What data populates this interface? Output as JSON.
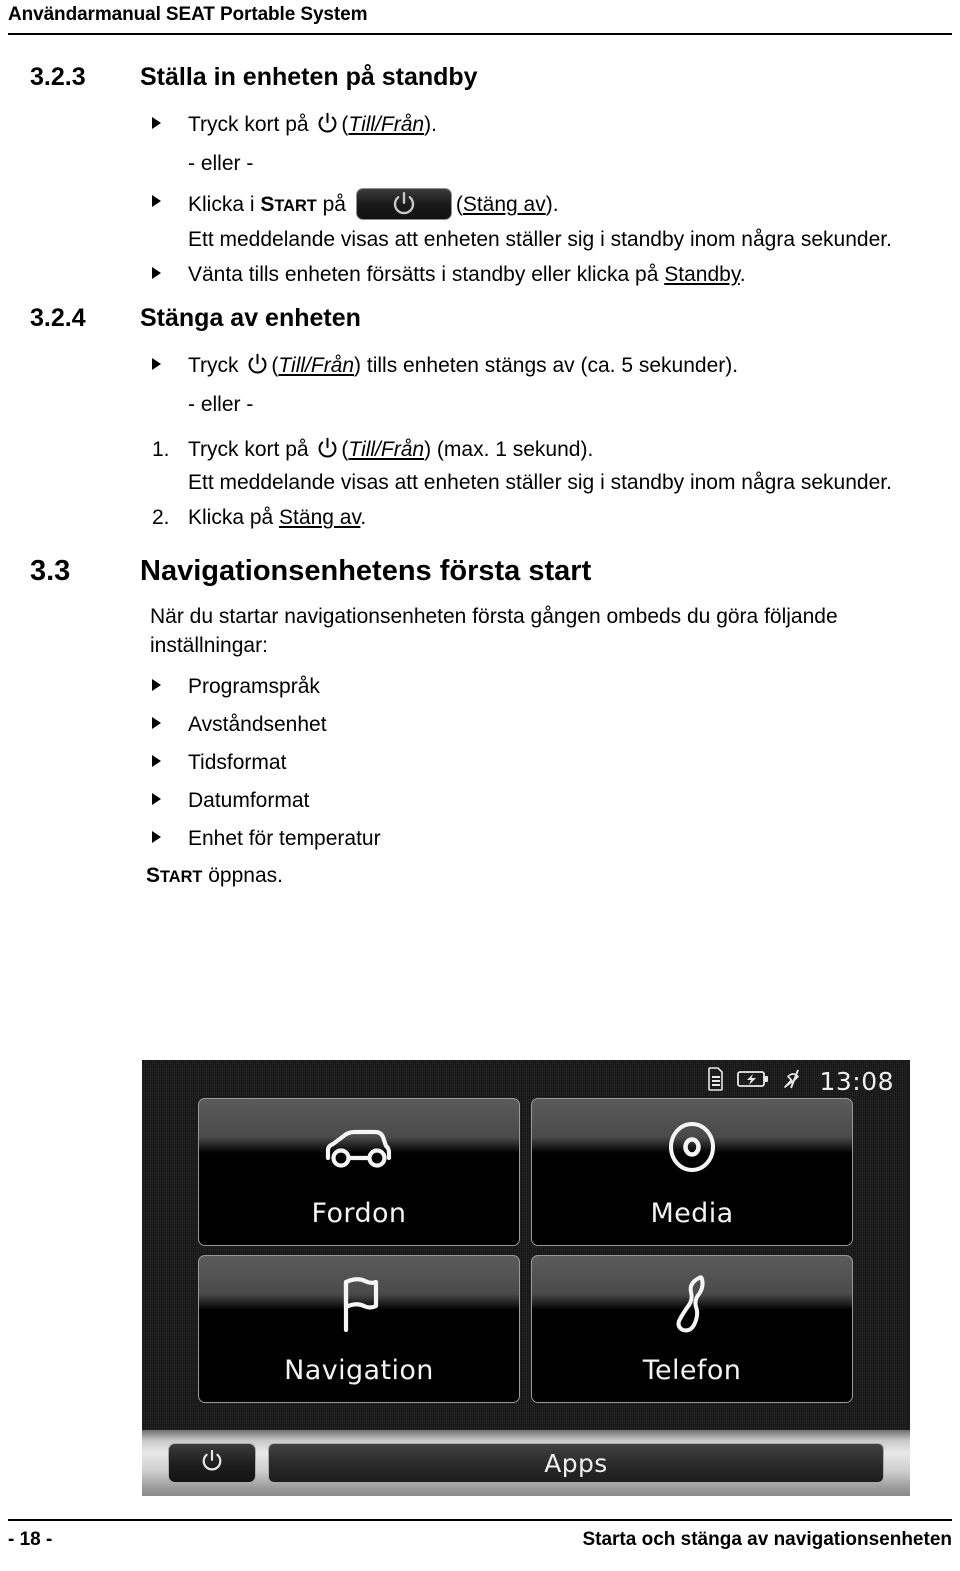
{
  "header": {
    "title": "Användarmanual SEAT Portable System"
  },
  "sections": [
    {
      "number": "3.2.3",
      "title": "Ställa in enheten på standby"
    },
    {
      "number": "3.2.4",
      "title": "Stänga av enheten"
    },
    {
      "number": "3.3",
      "title": "Navigationsenhetens första start"
    }
  ],
  "s323": {
    "item1_pre": "Tryck kort på ",
    "item1_paren_open": "(",
    "item1_link": "Till/Från",
    "item1_paren_close": ").",
    "or_label": "- eller -",
    "item2_pre": "Klicka i ",
    "item2_start": "START",
    "item2_mid": " på ",
    "item2_paren_open": "(",
    "item2_link": "Stäng av",
    "item2_paren_close": ").",
    "note": "Ett meddelande visas att enheten ställer sig i standby inom några sekunder.",
    "item3_pre": "Vänta tills enheten försätts i standby eller klicka på ",
    "item3_link": "Standby",
    "item3_post": "."
  },
  "s324": {
    "item1_pre": "Tryck ",
    "item1_paren_open": "(",
    "item1_link": "Till/Från",
    "item1_paren_close": ") tills enheten stängs av (ca. 5 sekunder).",
    "or_label": "- eller -",
    "step1_num": "1.",
    "step1_pre": "Tryck kort på ",
    "step1_paren_open": "(",
    "step1_link": "Till/Från",
    "step1_paren_close": ") (max. 1 sekund).",
    "step1_note": "Ett meddelande visas att enheten ställer sig i standby inom några sekunder.",
    "step2_num": "2.",
    "step2_pre": "Klicka på ",
    "step2_link": "Stäng av",
    "step2_post": "."
  },
  "s33": {
    "intro": "När du startar navigationsenheten första gången ombeds du göra följande inställningar:",
    "bullets": [
      "Programspråk",
      "Avståndsenhet",
      "Tidsformat",
      "Datumformat",
      "Enhet för temperatur"
    ],
    "outro_start": "START",
    "outro_rest": " öppnas."
  },
  "device": {
    "status": {
      "sd_card_icon": "sd-card-icon",
      "battery_icon": "battery-charging-icon",
      "gps_icon": "gps-no-signal-icon",
      "clock": "13:08"
    },
    "tiles": [
      {
        "label": "Fordon",
        "icon": "car-icon"
      },
      {
        "label": "Media",
        "icon": "disc-icon"
      },
      {
        "label": "Navigation",
        "icon": "flag-icon"
      },
      {
        "label": "Telefon",
        "icon": "phone-handset-icon"
      }
    ],
    "bottom": {
      "power_icon": "power-icon",
      "apps_label": "Apps"
    }
  },
  "footer": {
    "page_number": "- 18 -",
    "chapter": "Starta och stänga av navigationsenheten"
  },
  "colors": {
    "page_background": "#ffffff",
    "text": "#000000",
    "device_background": "#141414",
    "device_text": "#f2f2f2",
    "tile_border": "#9a9a9a"
  }
}
